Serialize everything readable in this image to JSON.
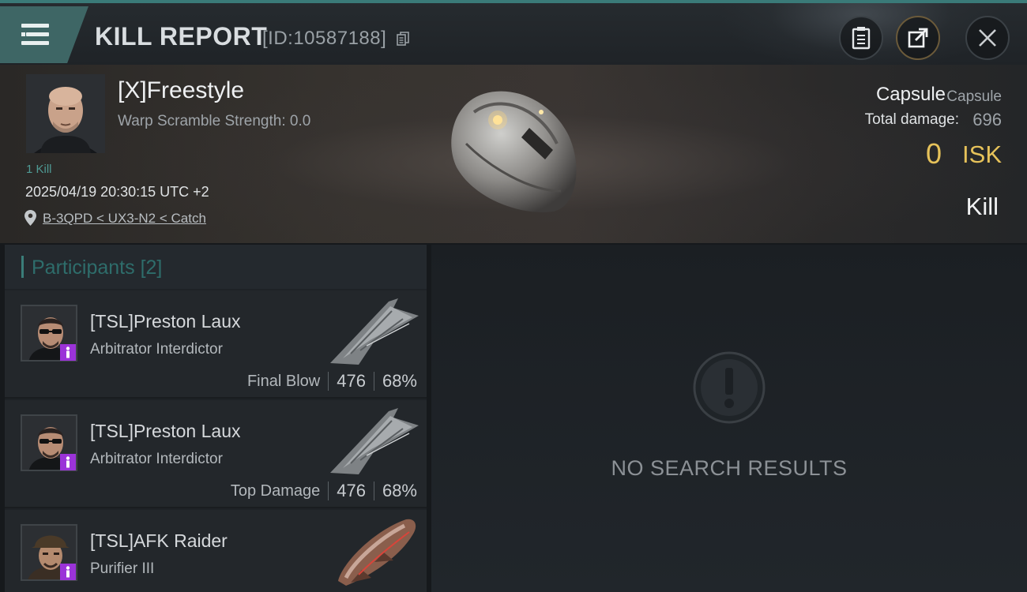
{
  "header": {
    "title": "KILL REPORT",
    "report_id": "[ID:10587188]"
  },
  "victim": {
    "name": "[X]Freestyle",
    "warp_scramble": "Warp Scramble Strength: 0.0",
    "kills": "1 Kill",
    "datetime": "2025/04/19 20:30:15 UTC +2",
    "location": "B-3QPD < UX3-N2 < Catch",
    "ship_name": "Capsule",
    "ship_type": "Capsule",
    "total_damage_label": "Total damage:",
    "total_damage_value": "696",
    "isk_value": "0",
    "isk_unit": "ISK",
    "result": "Kill"
  },
  "participants": {
    "label": "Participants",
    "count": "[2]",
    "rows": [
      {
        "name": "[TSL]Preston Laux",
        "ship": "Arbitrator Interdictor",
        "tag": "Final Blow",
        "damage": "476",
        "percent": "68%"
      },
      {
        "name": "[TSL]Preston Laux",
        "ship": "Arbitrator Interdictor",
        "tag": "Top Damage",
        "damage": "476",
        "percent": "68%"
      },
      {
        "name": "[TSL]AFK Raider",
        "ship": "Purifier III"
      }
    ]
  },
  "results": {
    "empty_text": "NO SEARCH RESULTS"
  },
  "colors": {
    "accent_teal": "#3a7a78",
    "isk_gold": "#e6c25a",
    "badge_purple": "#9b33d8"
  },
  "icons": [
    "menu-icon",
    "copy-icon",
    "clipboard-icon",
    "share-icon",
    "close-icon",
    "location-pin-icon",
    "exclamation-icon"
  ]
}
